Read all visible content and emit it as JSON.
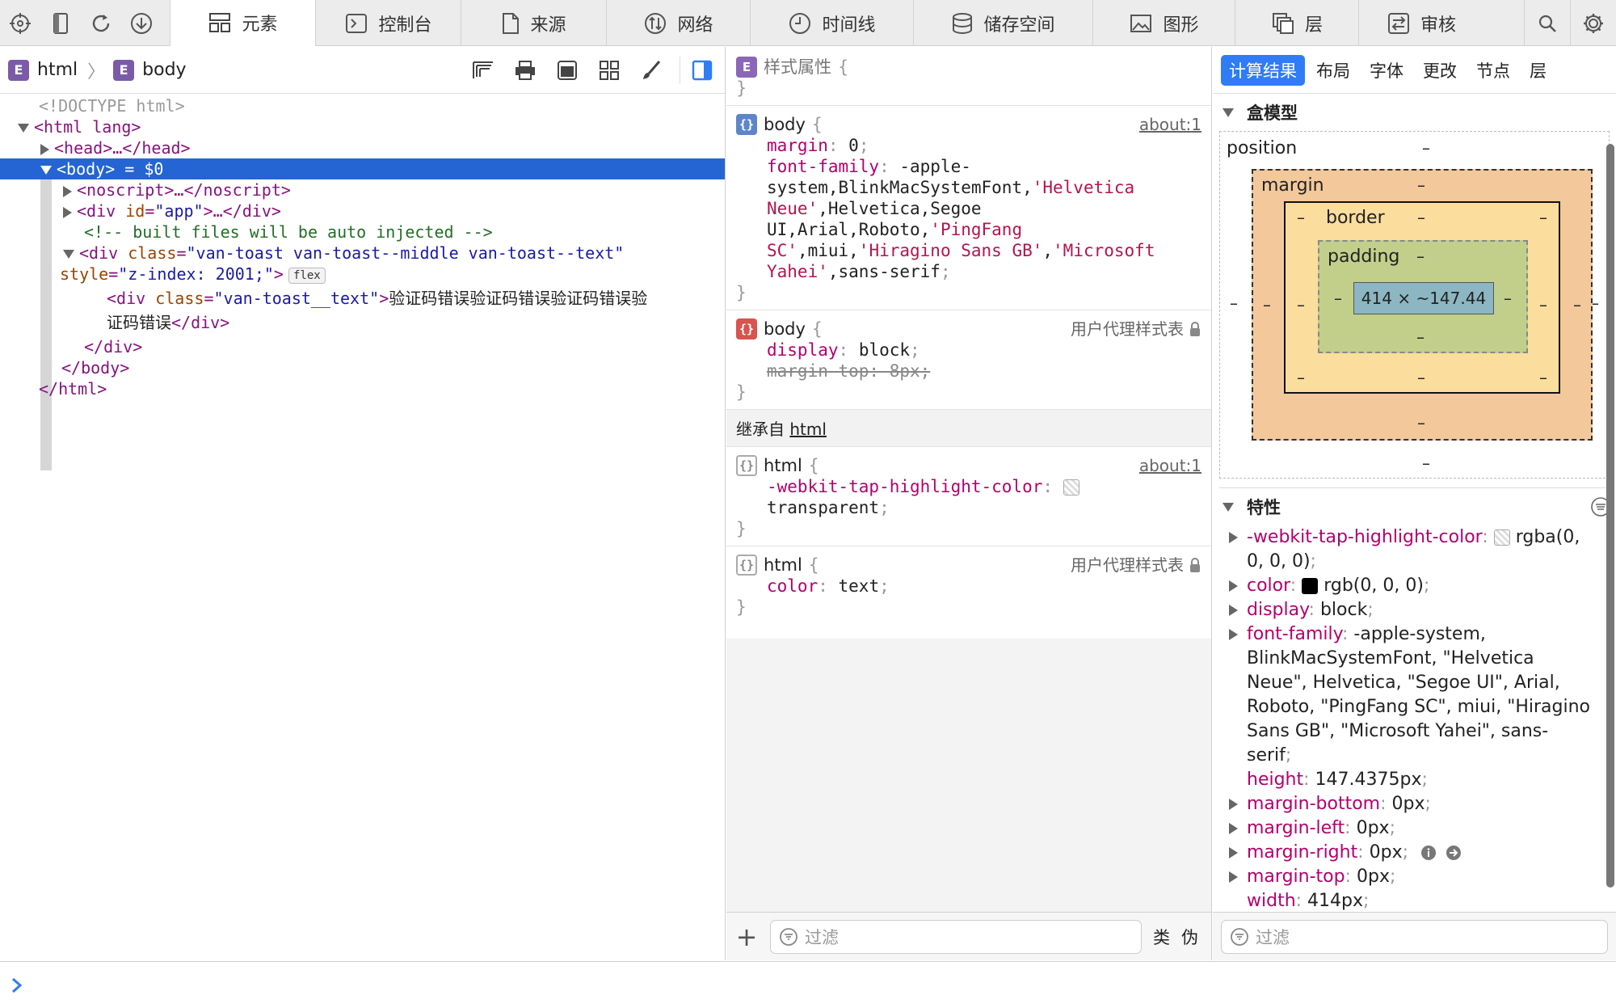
{
  "toolbar": {
    "tabs": [
      {
        "label": "元素",
        "icon": "elements-icon"
      },
      {
        "label": "控制台",
        "icon": "console-icon"
      },
      {
        "label": "来源",
        "icon": "sources-icon"
      },
      {
        "label": "网络",
        "icon": "network-icon"
      },
      {
        "label": "时间线",
        "icon": "timeline-icon"
      },
      {
        "label": "储存空间",
        "icon": "storage-icon"
      },
      {
        "label": "图形",
        "icon": "graphics-icon"
      },
      {
        "label": "层",
        "icon": "layers-icon"
      },
      {
        "label": "审核",
        "icon": "audit-icon"
      }
    ],
    "active_tab": "元素"
  },
  "breadcrumb": {
    "items": [
      "html",
      "body"
    ]
  },
  "dom": {
    "doctype": "<!DOCTYPE html>",
    "html_open": "<html lang>",
    "head": "<head>…</head>",
    "body_open": "<body>",
    "body_ref": " = $0",
    "noscript": "<noscript>…</noscript>",
    "div_app_open": "<div ",
    "div_app_attr": "id",
    "div_app_val": "\"app\"",
    "div_app_close": ">…</div>",
    "comment": "<!-- built files will be auto injected -->",
    "toast_open": "<div ",
    "toast_attr": "class",
    "toast_val": "\"van-toast van-toast--middle van-toast--text\"",
    "toast_style_attr": "style",
    "toast_style_val": "\"z-index: 2001;\"",
    "toast_gt": ">",
    "flex_badge": "flex",
    "text_div_open": "<div ",
    "text_div_attr": "class",
    "text_div_val": "\"van-toast__text\"",
    "text_div_gt": ">",
    "text_content_1": "验证码错误验证码错误验证码错误验",
    "text_content_2": "证码错误",
    "text_div_close": "</div>",
    "div_close": "</div>",
    "body_close": "</body>",
    "html_close": "</html>"
  },
  "styles": {
    "style_attr_label": "样式属性",
    "rule1": {
      "selector": "body",
      "source": "about:1",
      "margin_name": "margin",
      "margin_val": "0",
      "ff_name": "font-family",
      "ff_line1": "-apple-",
      "ff_line2_a": "system,BlinkMacSystemFont,",
      "ff_line2_b": "'Helvetica",
      "ff_line3_a": "Neue'",
      "ff_line3_b": ",Helvetica,Segoe",
      "ff_line4_a": "UI,Arial,Roboto,",
      "ff_line4_b": "'PingFang",
      "ff_line5_a": "SC'",
      "ff_line5_b": ",miui,",
      "ff_line5_c": "'Hiragino Sans GB'",
      "ff_line5_d": ",",
      "ff_line5_e": "'Microsoft",
      "ff_line6_a": "Yahei'",
      "ff_line6_b": ",sans-serif"
    },
    "rule2": {
      "selector": "body",
      "source": "用户代理样式表",
      "display_name": "display",
      "display_val": "block",
      "mt_text": "margin-top: 8px;"
    },
    "inherited_label": "继承自",
    "inherited_from": "html",
    "rule3": {
      "selector": "html",
      "source": "about:1",
      "prop_name": "-webkit-tap-highlight-color",
      "prop_val": "transparent"
    },
    "rule4": {
      "selector": "html",
      "source": "用户代理样式表",
      "prop_name": "color",
      "prop_val": "text"
    },
    "filter_placeholder": "过滤",
    "classes_btn": "类",
    "pseudo_btn": "伪"
  },
  "computed": {
    "tabs": [
      "计算结果",
      "布局",
      "字体",
      "更改",
      "节点",
      "层"
    ],
    "active_tab": "计算结果",
    "boxmodel_title": "盒模型",
    "position_label": "position",
    "margin_label": "margin",
    "border_label": "border",
    "padding_label": "padding",
    "content_size": "414 × ~147.44",
    "dash": "–",
    "props_title": "特性",
    "props": [
      {
        "name": "-webkit-tap-highlight-color",
        "value": "rgba(0,",
        "cont": "0, 0, 0)",
        "expand": true,
        "swatch": "checker"
      },
      {
        "name": "color",
        "value": "rgb(0, 0, 0)",
        "expand": true,
        "swatch": "#000000"
      },
      {
        "name": "display",
        "value": "block",
        "expand": true
      },
      {
        "name": "font-family",
        "value": "-apple-system,",
        "expand": true
      },
      {
        "name": "height",
        "value": "147.4375px",
        "expand": false
      },
      {
        "name": "margin-bottom",
        "value": "0px",
        "expand": true
      },
      {
        "name": "margin-left",
        "value": "0px",
        "expand": true
      },
      {
        "name": "margin-right",
        "value": "0px",
        "expand": true
      },
      {
        "name": "margin-top",
        "value": "0px",
        "expand": true
      },
      {
        "name": "width",
        "value": "414px",
        "expand": false
      }
    ],
    "ff_cont": [
      "BlinkMacSystemFont, \"Helvetica",
      "Neue\", Helvetica, \"Segoe UI\", Arial,",
      "Roboto, \"PingFang SC\", miui, \"Hiragino",
      "Sans GB\", \"Microsoft Yahei\", sans-",
      "serif"
    ],
    "filter_placeholder": "过滤"
  },
  "colors": {
    "selection": "#2465d3",
    "accent": "#2f7cf6",
    "margin_box": "#f3c89a",
    "border_box": "#fbdd9d",
    "padding_box": "#c2cf8a",
    "content_box": "#8cb6c1"
  }
}
